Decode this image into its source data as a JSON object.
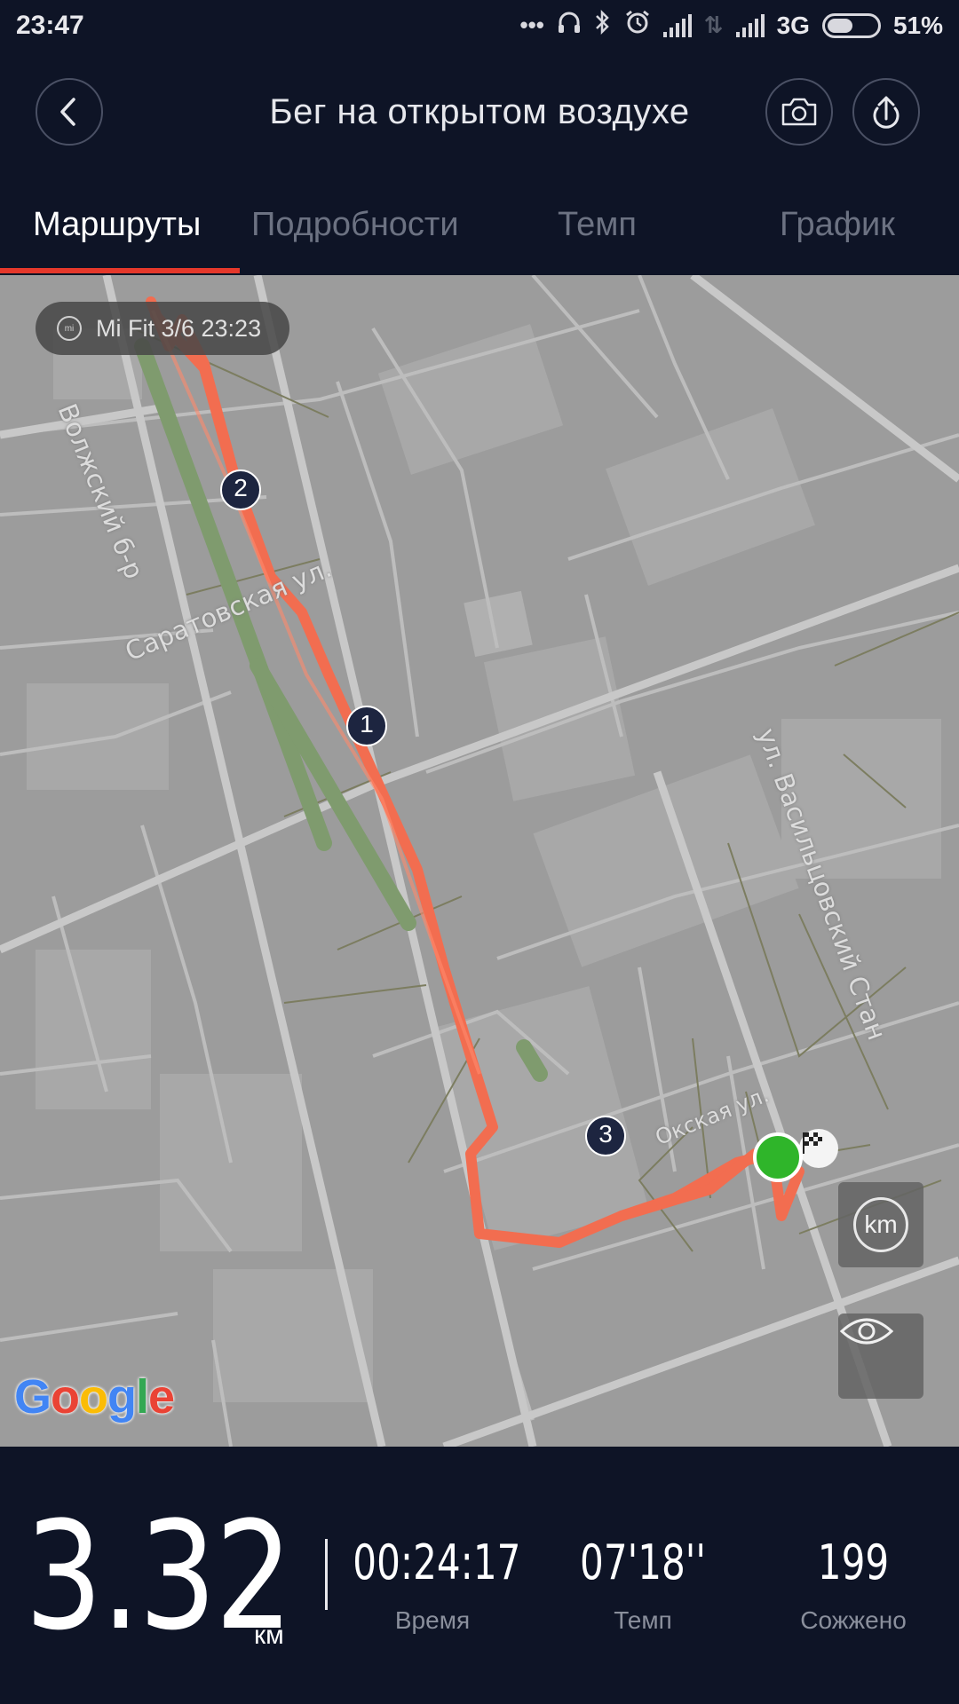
{
  "status_bar": {
    "time": "23:47",
    "network": "3G",
    "battery": "51%",
    "battery_level": 0.51,
    "icons": [
      "more-icon",
      "headphones-icon",
      "bluetooth-icon",
      "alarm-icon",
      "signal-icon",
      "data-transfer-icon",
      "signal-icon"
    ]
  },
  "header": {
    "title": "Бег на открытом воздухе",
    "back_icon": "back-arrow-icon",
    "camera_icon": "camera-icon",
    "share_icon": "share-upload-icon"
  },
  "tabs": [
    {
      "label": "Маршруты",
      "active": true
    },
    {
      "label": "Подробности",
      "active": false
    },
    {
      "label": "Темп",
      "active": false
    },
    {
      "label": "График",
      "active": false
    }
  ],
  "map": {
    "record_badge": "Mi Fit 3/6 23:23",
    "badge_icon": "mi-logo-icon",
    "km_button": "km",
    "visibility_icon": "eye-icon",
    "provider": "Google",
    "streets": [
      "Волжский б-р",
      "Саратовская ул.",
      "ул. Васильцовский Стан",
      "Окская ул."
    ],
    "km_markers": [
      "1",
      "2",
      "3"
    ],
    "start_icon": "start-point-icon",
    "finish_icon": "finish-flag-icon",
    "route_color": "#f26d50",
    "park_color": "#7f9b6e"
  },
  "stats": {
    "distance": "3.32",
    "distance_unit": "км",
    "time": {
      "value": "00:24:17",
      "label": "Время"
    },
    "pace": {
      "value": "07'18''",
      "label": "Темп"
    },
    "calories": {
      "value": "199",
      "label": "Сожжено"
    }
  },
  "colors": {
    "background": "#0e1426",
    "accent": "#e5382b",
    "inactive_tab": "#6c7282"
  }
}
